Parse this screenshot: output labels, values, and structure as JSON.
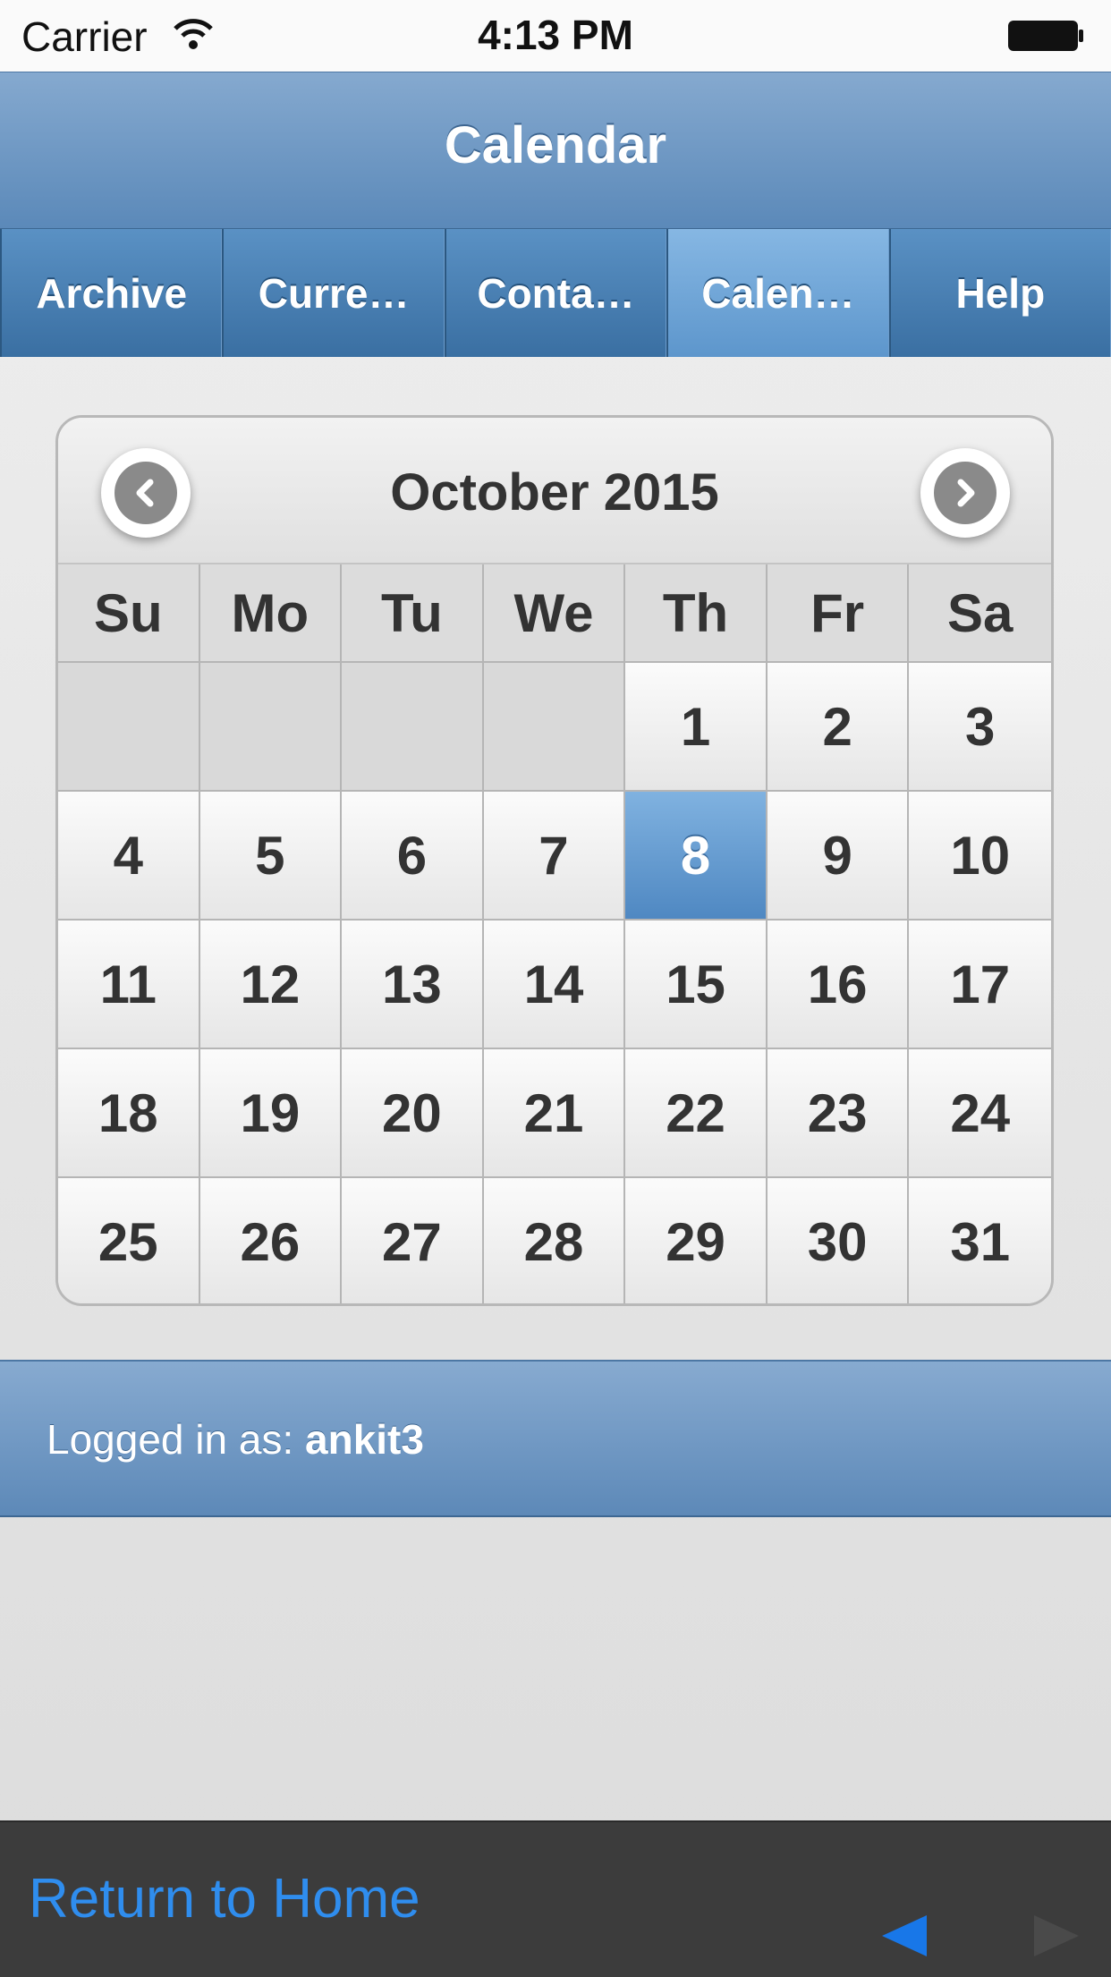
{
  "status_bar": {
    "carrier": "Carrier",
    "time": "4:13 PM",
    "icons": [
      "wifi-icon",
      "battery-icon"
    ]
  },
  "header": {
    "title": "Calendar"
  },
  "navbar": {
    "tabs": [
      {
        "label": "Archive",
        "active": false
      },
      {
        "label": "Curre…",
        "active": false
      },
      {
        "label": "Conta…",
        "active": false
      },
      {
        "label": "Calen…",
        "active": true
      },
      {
        "label": "Help",
        "active": false
      }
    ]
  },
  "calendar": {
    "month_title": "October 2015",
    "prev_icon": "chevron-left-icon",
    "next_icon": "chevron-right-icon",
    "weekdays": [
      "Su",
      "Mo",
      "Tu",
      "We",
      "Th",
      "Fr",
      "Sa"
    ],
    "days": [
      "",
      "",
      "",
      "",
      "1",
      "2",
      "3",
      "4",
      "5",
      "6",
      "7",
      "8",
      "9",
      "10",
      "11",
      "12",
      "13",
      "14",
      "15",
      "16",
      "17",
      "18",
      "19",
      "20",
      "21",
      "22",
      "23",
      "24",
      "25",
      "26",
      "27",
      "28",
      "29",
      "30",
      "31"
    ],
    "selected_day": "8",
    "accent_color": "#5b93c9"
  },
  "footer": {
    "prefix": "Logged in as: ",
    "username": "ankit3"
  },
  "toolbar": {
    "home_label": "Return to Home",
    "back_icon": "back-arrow-icon",
    "forward_icon": "forward-arrow-icon",
    "link_color": "#2f8dee"
  }
}
